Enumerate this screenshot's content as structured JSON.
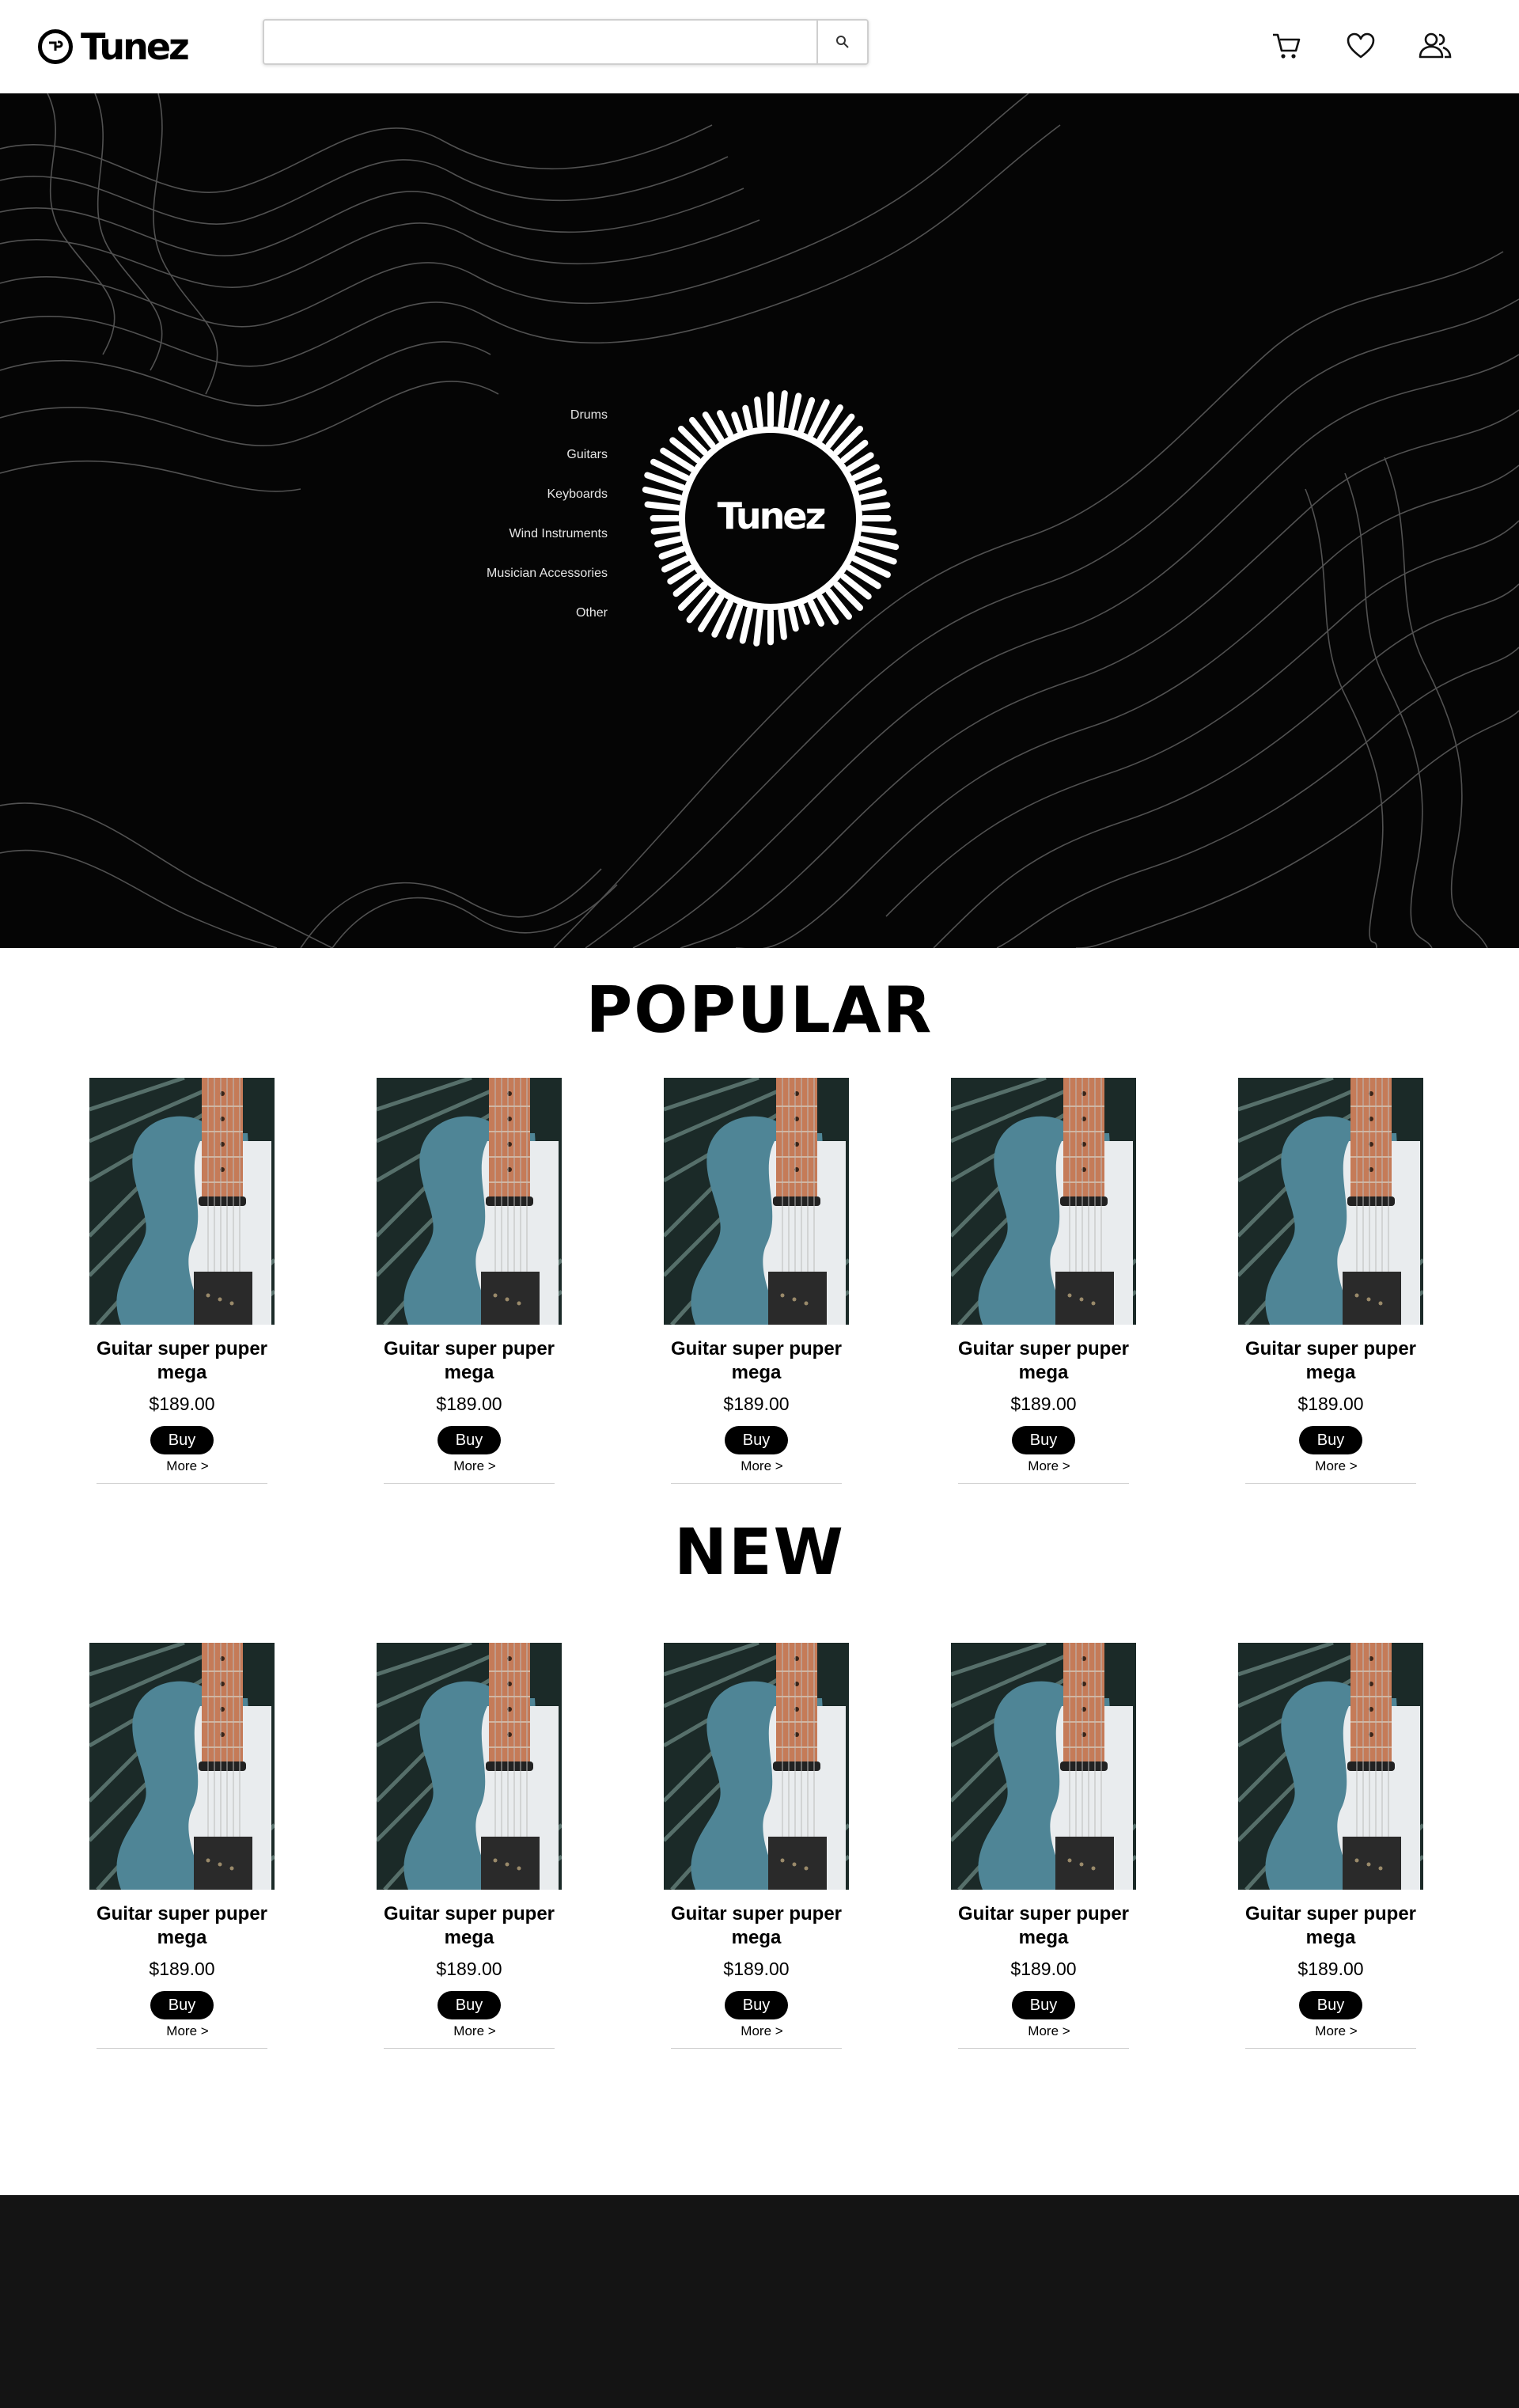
{
  "header": {
    "logo_text": "Tunez",
    "search_placeholder": ""
  },
  "hero": {
    "categories": [
      "Drums",
      "Guitars",
      "Keyboards",
      "Wind Instruments",
      "Musician Accessories",
      "Other"
    ],
    "badge_text": "Tunez"
  },
  "popular": {
    "title": "POPULAR",
    "products": [
      {
        "name": "Guitar super puper mega",
        "price": "$189.00",
        "buy": "Buy",
        "more": "More >"
      },
      {
        "name": "Guitar super puper mega",
        "price": "$189.00",
        "buy": "Buy",
        "more": "More >"
      },
      {
        "name": "Guitar super puper mega",
        "price": "$189.00",
        "buy": "Buy",
        "more": "More >"
      },
      {
        "name": "Guitar super puper mega",
        "price": "$189.00",
        "buy": "Buy",
        "more": "More >"
      },
      {
        "name": "Guitar super puper mega",
        "price": "$189.00",
        "buy": "Buy",
        "more": "More >"
      }
    ]
  },
  "new": {
    "title": "NEW",
    "products": [
      {
        "name": "Guitar super puper mega",
        "price": "$189.00",
        "buy": "Buy",
        "more": "More >"
      },
      {
        "name": "Guitar super puper mega",
        "price": "$189.00",
        "buy": "Buy",
        "more": "More >"
      },
      {
        "name": "Guitar super puper mega",
        "price": "$189.00",
        "buy": "Buy",
        "more": "More >"
      },
      {
        "name": "Guitar super puper mega",
        "price": "$189.00",
        "buy": "Buy",
        "more": "More >"
      },
      {
        "name": "Guitar super puper mega",
        "price": "$189.00",
        "buy": "Buy",
        "more": "More >"
      }
    ]
  },
  "colors": {
    "hero_bg": "#050505",
    "footer_bg": "#141414",
    "guitar_body": "#4f8596"
  },
  "icons": {
    "cart": "cart-icon",
    "wishlist": "heart-icon",
    "account": "user-icon",
    "search": "search-icon"
  }
}
